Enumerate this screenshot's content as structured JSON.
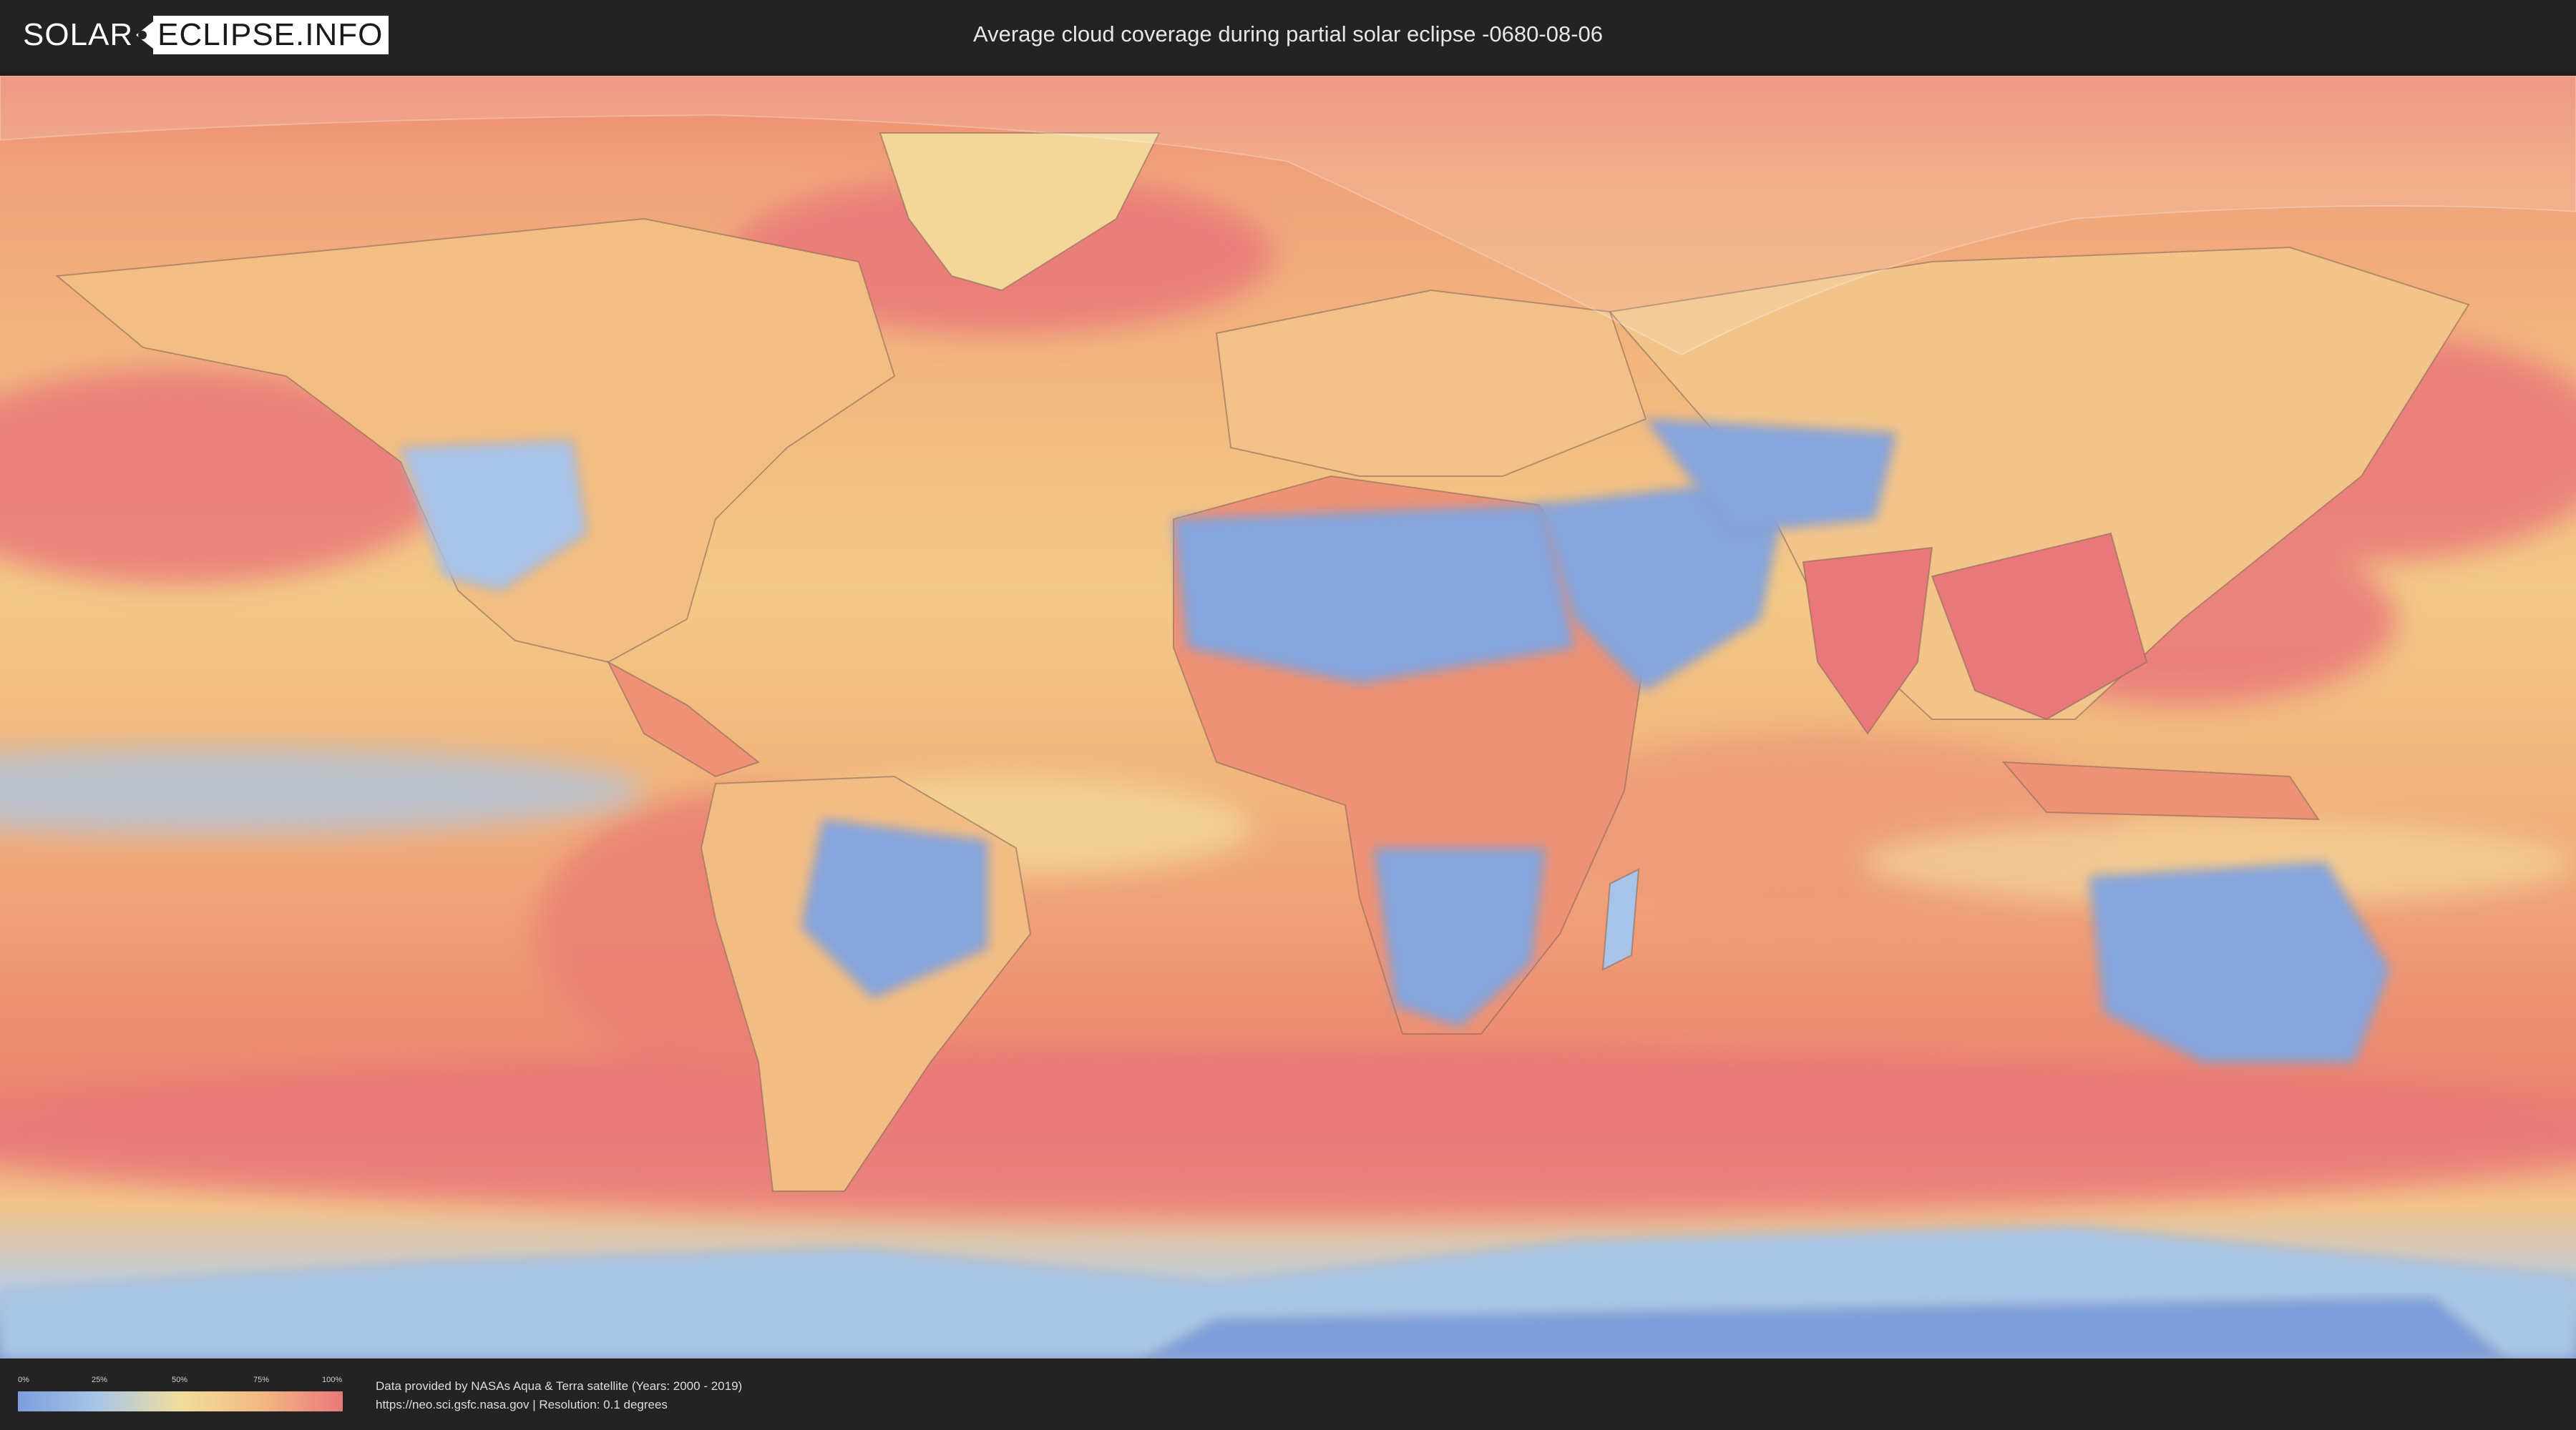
{
  "header": {
    "logo": {
      "part1": "SOLAR",
      "part2": "ECLIPSE.INFO"
    },
    "title": "Average cloud coverage during partial solar eclipse -0680-08-06"
  },
  "map": {
    "projection": "equirectangular",
    "layer": "average cloud coverage",
    "eclipse_region": "partial eclipse visibility zone (northern high latitudes, shaded)"
  },
  "legend": {
    "ticks": [
      "0%",
      "25%",
      "50%",
      "75%",
      "100%"
    ],
    "colors": [
      "#7b9fdc",
      "#a9c6e6",
      "#f2de9c",
      "#f2b883",
      "#e9787a"
    ]
  },
  "footer": {
    "credit_line1": "Data provided by NASAs Aqua & Terra satellite (Years: 2000 - 2019)",
    "credit_line2": "https://neo.sci.gsfc.nasa.gov | Resolution: 0.1 degrees"
  }
}
